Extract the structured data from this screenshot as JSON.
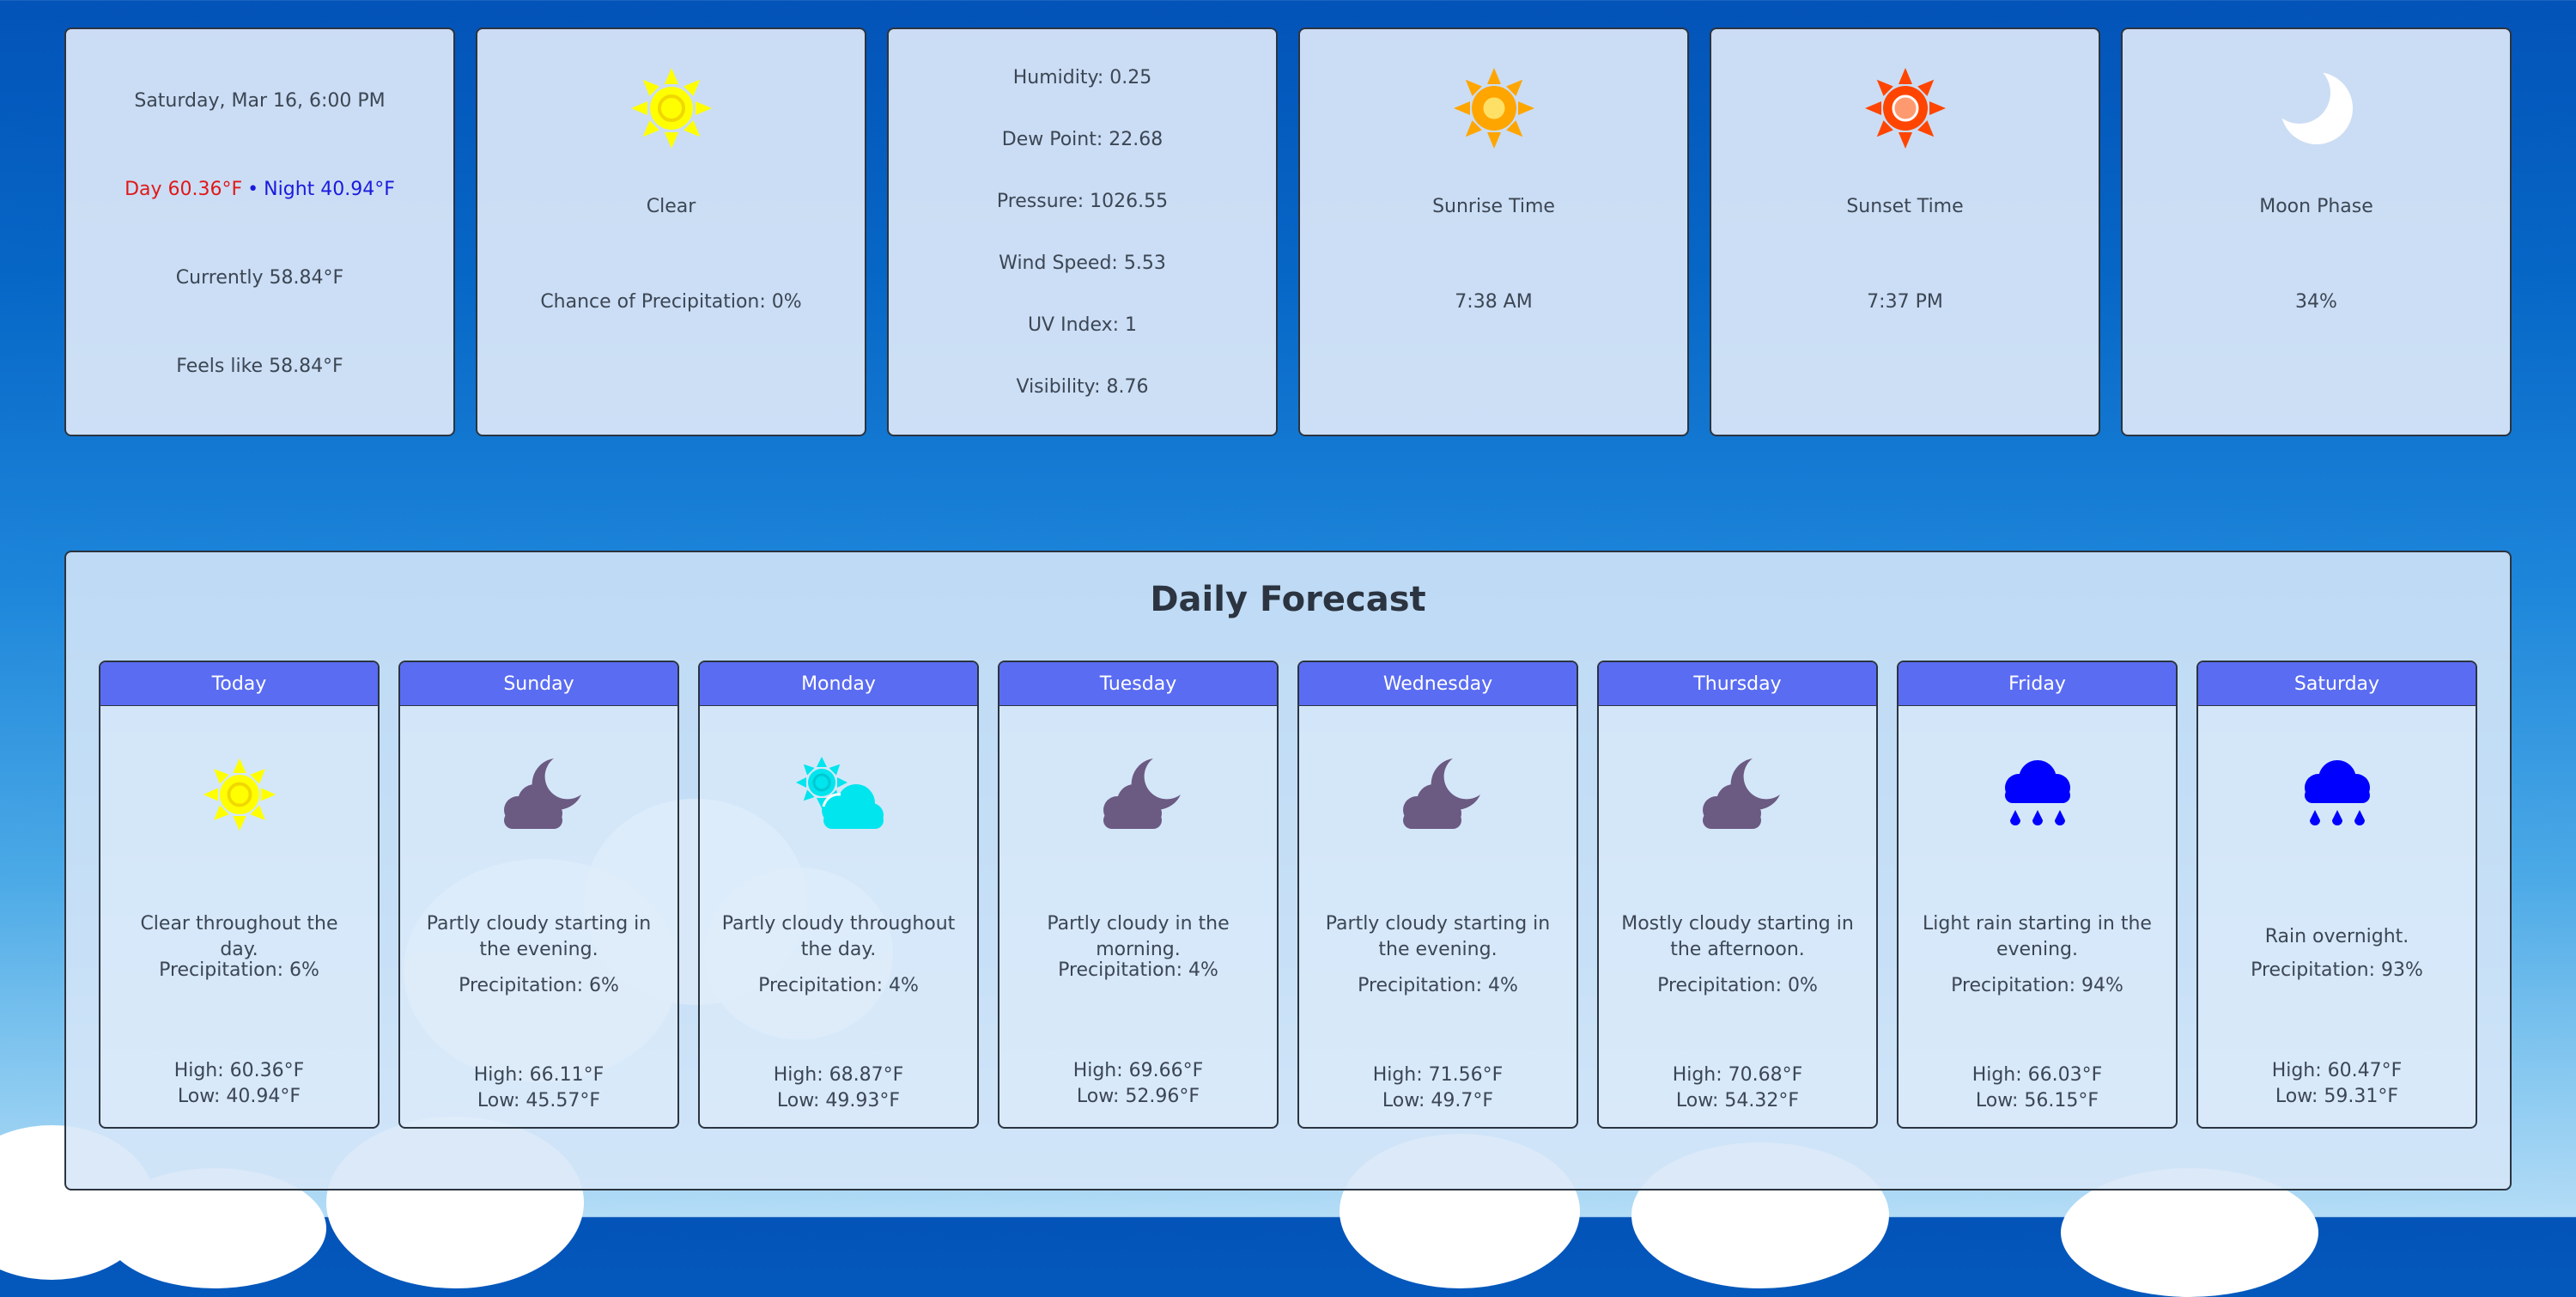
{
  "colors": {
    "header_blue": "#5a6cf2",
    "day_temp_red": "#e01818",
    "night_temp_blue": "#1a1adc",
    "sun_yellow": "#ffff00",
    "sun_orange": "#ffa500",
    "sunset_red": "#ff4500",
    "cloud_purple": "#6b5a82",
    "partly_cloudy_cyan": "#00e5ee",
    "rain_blue": "#0000ff"
  },
  "current": {
    "datetime": "Saturday, Mar 16, 6:00 PM",
    "day_temp": "Day 60.36°F",
    "separator": "•",
    "night_temp": "Night 40.94°F",
    "currently": "Currently 58.84°F",
    "feels_like": "Feels like 58.84°F"
  },
  "condition": {
    "icon": "sun-icon",
    "label": "Clear",
    "precip": "Chance of Precipitation: 0%"
  },
  "details": {
    "humidity": "Humidity: 0.25",
    "dew_point": "Dew Point: 22.68",
    "pressure": "Pressure: 1026.55",
    "wind_speed": "Wind Speed: 5.53",
    "uv_index": "UV Index: 1",
    "visibility": "Visibility: 8.76"
  },
  "sunrise": {
    "icon": "sunrise-icon",
    "label": "Sunrise Time",
    "value": "7:38 AM"
  },
  "sunset": {
    "icon": "sunset-icon",
    "label": "Sunset Time",
    "value": "7:37 PM"
  },
  "moon": {
    "icon": "moon-icon",
    "label": "Moon Phase",
    "value": "34%"
  },
  "forecast": {
    "title": "Daily Forecast",
    "days": [
      {
        "name": "Today",
        "icon": "clear-day",
        "summary": "Clear throughout the day.",
        "precip": "Precipitation: 6%",
        "high": "High: 60.36°F",
        "low": "Low: 40.94°F"
      },
      {
        "name": "Sunday",
        "icon": "partly-cloudy-night",
        "summary": "Partly cloudy starting in the evening.",
        "precip": "Precipitation: 6%",
        "high": "High: 66.11°F",
        "low": "Low: 45.57°F"
      },
      {
        "name": "Monday",
        "icon": "partly-cloudy-day",
        "summary": "Partly cloudy throughout the day.",
        "precip": "Precipitation: 4%",
        "high": "High: 68.87°F",
        "low": "Low: 49.93°F"
      },
      {
        "name": "Tuesday",
        "icon": "partly-cloudy-night",
        "summary": "Partly cloudy in the morning.",
        "precip": "Precipitation: 4%",
        "high": "High: 69.66°F",
        "low": "Low: 52.96°F"
      },
      {
        "name": "Wednesday",
        "icon": "partly-cloudy-night",
        "summary": "Partly cloudy starting in the evening.",
        "precip": "Precipitation: 4%",
        "high": "High: 71.56°F",
        "low": "Low: 49.7°F"
      },
      {
        "name": "Thursday",
        "icon": "partly-cloudy-night",
        "summary": "Mostly cloudy starting in the afternoon.",
        "precip": "Precipitation: 0%",
        "high": "High: 70.68°F",
        "low": "Low: 54.32°F"
      },
      {
        "name": "Friday",
        "icon": "rain",
        "summary": "Light rain starting in the evening.",
        "precip": "Precipitation: 94%",
        "high": "High: 66.03°F",
        "low": "Low: 56.15°F"
      },
      {
        "name": "Saturday",
        "icon": "rain",
        "summary": "Rain overnight.",
        "precip": "Precipitation: 93%",
        "high": "High: 60.47°F",
        "low": "Low: 59.31°F"
      }
    ]
  }
}
